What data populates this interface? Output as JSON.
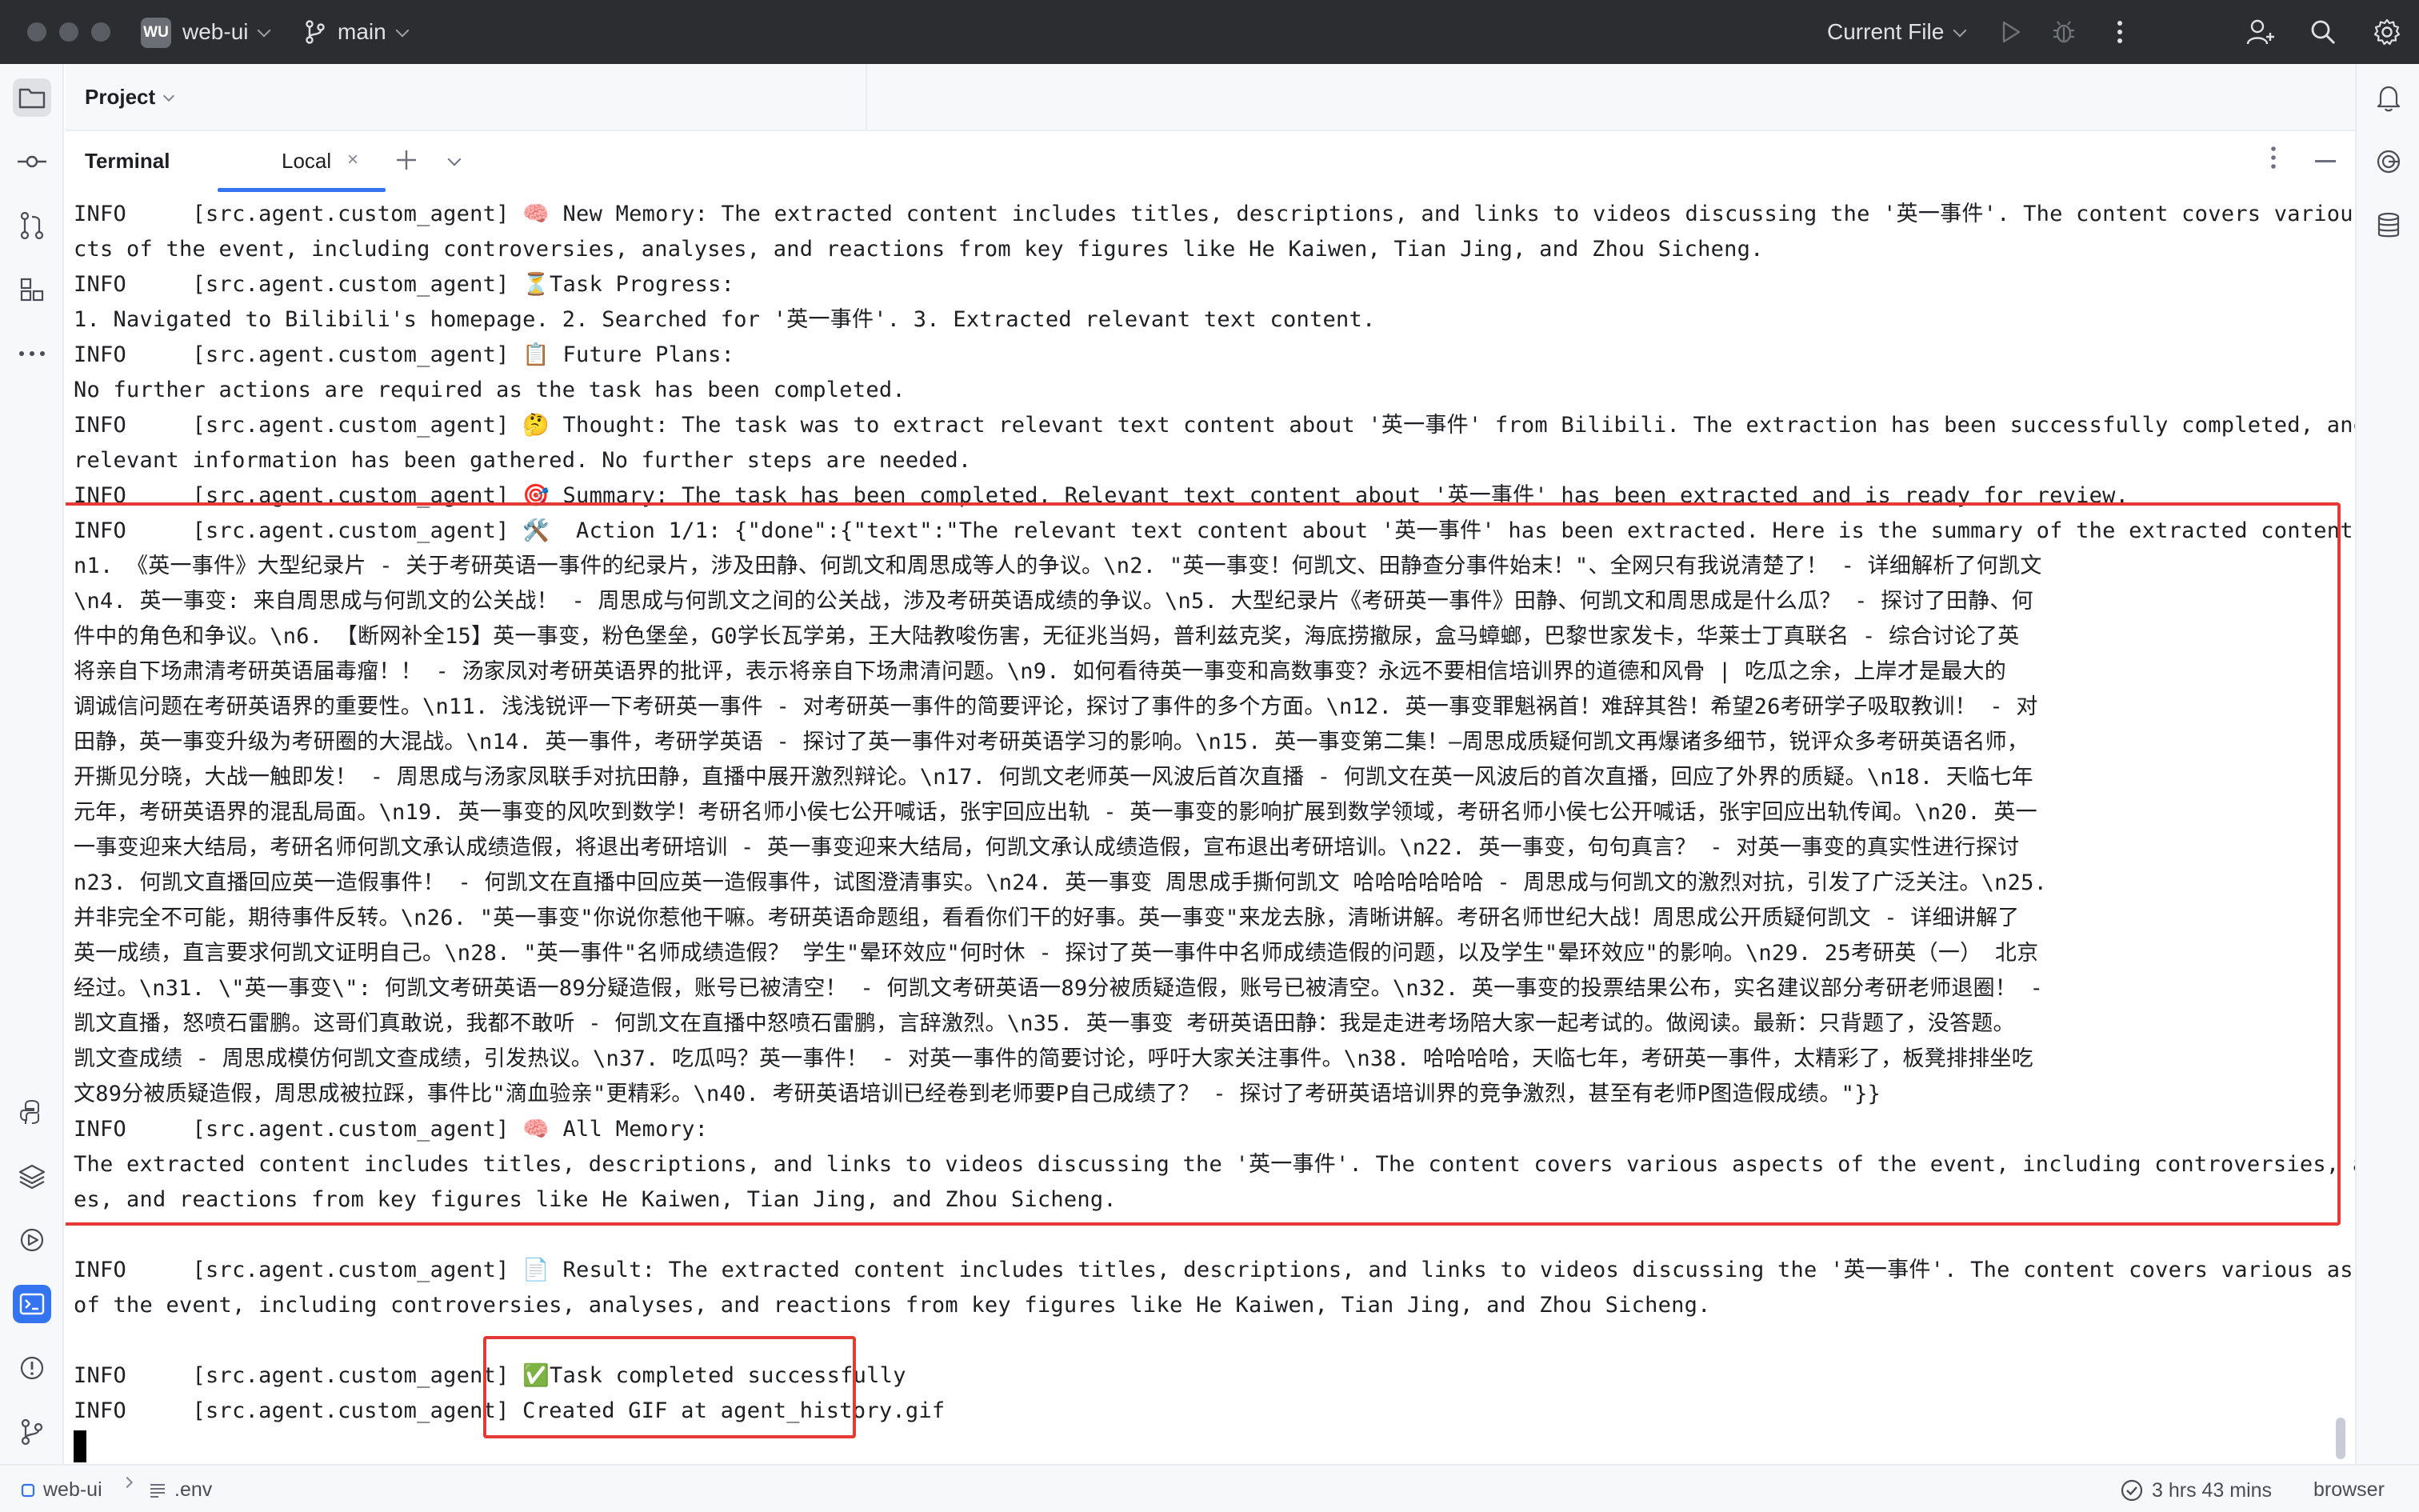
{
  "titlebar": {
    "project_badge": "WU",
    "project_name": "web-ui",
    "branch": "main",
    "run_config": "Current File"
  },
  "project_panel": {
    "title": "Project"
  },
  "terminal": {
    "title": "Terminal",
    "tab_label": "Local",
    "close_glyph": "×",
    "lines": [
      "INFO     [src.agent.custom_agent] 🧠 New Memory: The extracted content includes titles, descriptions, and links to videos discussing the '英一事件'. The content covers various",
      "cts of the event, including controversies, analyses, and reactions from key figures like He Kaiwen, Tian Jing, and Zhou Sicheng.",
      "INFO     [src.agent.custom_agent] ⏳Task Progress:",
      "1. Navigated to Bilibili's homepage. 2. Searched for '英一事件'. 3. Extracted relevant text content.",
      "INFO     [src.agent.custom_agent] 📋 Future Plans:",
      "No further actions are required as the task has been completed.",
      "INFO     [src.agent.custom_agent] 🤔 Thought: The task was to extract relevant text content about '英一事件' from Bilibili. The extraction has been successfully completed, and",
      "relevant information has been gathered. No further steps are needed.",
      "INFO     [src.agent.custom_agent] 🎯 Summary: The task has been completed. Relevant text content about '英一事件' has been extracted and is ready for review.",
      "INFO     [src.agent.custom_agent] 🛠️  Action 1/1: {\"done\":{\"text\":\"The relevant text content about '英一事件' has been extracted. Here is the summary of the extracted content:",
      "n1. 《英一事件》大型纪录片 - 关于考研英语一事件的纪录片，涉及田静、何凯文和周思成等人的争议。\\n2. \"英一事变！何凯文、田静查分事件始末！\"、全网只有我说清楚了！ - 详细解析了何凯文",
      "\\n4. 英一事变: 来自周思成与何凯文的公关战！ - 周思成与何凯文之间的公关战，涉及考研英语成绩的争议。\\n5. 大型纪录片《考研英一事件》田静、何凯文和周思成是什么瓜？ - 探讨了田静、何",
      "件中的角色和争议。\\n6. 【断网补全15】英一事变，粉色堡垒，G0学长瓦学弟，王大陆教唆伤害，无征兆当妈，普利兹克奖，海底捞撤尿，盒马蟑螂，巴黎世家发卡，华莱士丁真联名 - 综合讨论了英",
      "将亲自下场肃清考研英语届毒瘤！！ - 汤家凤对考研英语界的批评，表示将亲自下场肃清问题。\\n9. 如何看待英一事变和高数事变？永远不要相信培训界的道德和风骨 | 吃瓜之余，上岸才是最大的",
      "调诚信问题在考研英语界的重要性。\\n11. 浅浅锐评一下考研英一事件 - 对考研英一事件的简要评论，探讨了事件的多个方面。\\n12. 英一事变罪魁祸首！难辞其咎！希望26考研学子吸取教训！ - 对",
      "田静，英一事变升级为考研圈的大混战。\\n14. 英一事件，考研学英语 - 探讨了英一事件对考研英语学习的影响。\\n15. 英一事变第二集！—周思成质疑何凯文再爆诸多细节，锐评众多考研英语名师，",
      "开撕见分晓，大战一触即发！ - 周思成与汤家凤联手对抗田静，直播中展开激烈辩论。\\n17. 何凯文老师英一风波后首次直播 - 何凯文在英一风波后的首次直播，回应了外界的质疑。\\n18. 天临七年",
      "元年，考研英语界的混乱局面。\\n19. 英一事变的风吹到数学！考研名师小侯七公开喊话，张宇回应出轨 - 英一事变的影响扩展到数学领域，考研名师小侯七公开喊话，张宇回应出轨传闻。\\n20. 英一",
      "一事变迎来大结局，考研名师何凯文承认成绩造假，将退出考研培训 - 英一事变迎来大结局，何凯文承认成绩造假，宣布退出考研培训。\\n22. 英一事变，句句真言？ - 对英一事变的真实性进行探讨",
      "n23. 何凯文直播回应英一造假事件！ - 何凯文在直播中回应英一造假事件，试图澄清事实。\\n24. 英一事变 周思成手撕何凯文 哈哈哈哈哈哈 - 周思成与何凯文的激烈对抗，引发了广泛关注。\\n25.",
      "并非完全不可能，期待事件反转。\\n26. \"英一事变\"你说你惹他干嘛。考研英语命题组，看看你们干的好事。英一事变\"来龙去脉，清晰讲解。考研名师世纪大战！周思成公开质疑何凯文 - 详细讲解了",
      "英一成绩，直言要求何凯文证明自己。\\n28. \"英一事件\"名师成绩造假？ 学生\"晕环效应\"何时休 - 探讨了英一事件中名师成绩造假的问题，以及学生\"晕环效应\"的影响。\\n29. 25考研英（一） 北京",
      "经过。\\n31. \\\"英一事变\\\": 何凯文考研英语一89分疑造假，账号已被清空！ - 何凯文考研英语一89分被质疑造假，账号已被清空。\\n32. 英一事变的投票结果公布，实名建议部分考研老师退圈！ -",
      "凯文直播，怒喷石雷鹏。这哥们真敢说，我都不敢听 - 何凯文在直播中怒喷石雷鹏，言辞激烈。\\n35. 英一事变 考研英语田静：我是走进考场陪大家一起考试的。做阅读。最新：只背题了，没答题。",
      "凯文查成绩 - 周思成模仿何凯文查成绩，引发热议。\\n37. 吃瓜吗？英一事件！ - 对英一事件的简要讨论，呼吁大家关注事件。\\n38. 哈哈哈哈，天临七年，考研英一事件，太精彩了，板凳排排坐吃",
      "文89分被质疑造假，周思成被拉踩，事件比\"滴血验亲\"更精彩。\\n40. 考研英语培训已经卷到老师要P自己成绩了？ - 探讨了考研英语培训界的竞争激烈，甚至有老师P图造假成绩。\"}}",
      "INFO     [src.agent.custom_agent] 🧠 All Memory:",
      "The extracted content includes titles, descriptions, and links to videos discussing the '英一事件'. The content covers various aspects of the event, including controversies, an",
      "es, and reactions from key figures like He Kaiwen, Tian Jing, and Zhou Sicheng.",
      "",
      "INFO     [src.agent.custom_agent] 📄 Result: The extracted content includes titles, descriptions, and links to videos discussing the '英一事件'. The content covers various aspe",
      "of the event, including controversies, analyses, and reactions from key figures like He Kaiwen, Tian Jing, and Zhou Sicheng.",
      "",
      "INFO     [src.agent.custom_agent] ✅Task completed successfully",
      "INFO     [src.agent.custom_agent] Created GIF at agent_history.gif"
    ]
  },
  "statusbar": {
    "project": "web-ui",
    "file": ".env",
    "time": "3 hrs 43 mins",
    "browser": "browser"
  },
  "colors": {
    "accent": "#3574f0",
    "highlight": "#e53935",
    "titlebar_bg": "#2b2d30"
  }
}
